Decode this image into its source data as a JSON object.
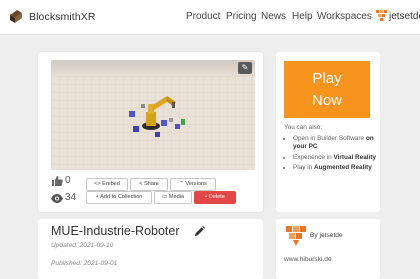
{
  "header": {
    "brand": "BlocksmithXR",
    "nav": [
      "Product",
      "Pricing",
      "News",
      "Help",
      "Workspaces"
    ],
    "user": "jetsetde"
  },
  "project": {
    "likes": "0",
    "views": "34",
    "actions": {
      "embed": "Embed",
      "share": "Share",
      "versions": "Versions",
      "add_to_collection": "Add to Collection",
      "media": "Media",
      "delete": "Delete"
    },
    "title": "MUE-Industrie-Roboter",
    "updated": "Updated: 2021-09-10",
    "published": "Published: 2021-09-01"
  },
  "play": {
    "line1": "Play",
    "line2": "Now",
    "also": "You can also:",
    "items": [
      {
        "pre": "Open in Builder Software ",
        "bold": "on your PC"
      },
      {
        "pre": "Experience in ",
        "bold": "Virtual Reality"
      },
      {
        "pre": "Play in ",
        "bold": "Augmented Reality"
      }
    ]
  },
  "author": {
    "by": "By jetsetde",
    "url": "www.hiburski.de"
  },
  "colors": {
    "play_orange": "#f7941d",
    "delete_red": "#e24848",
    "logo_orange": "#e8762b"
  }
}
